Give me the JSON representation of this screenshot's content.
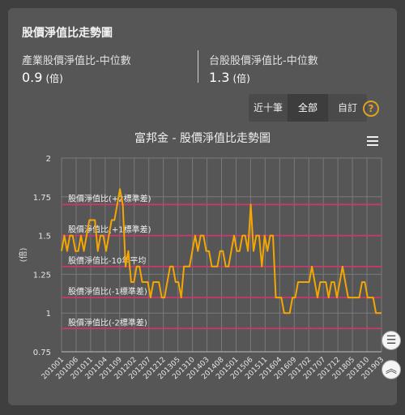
{
  "header": {
    "title": "股價淨值比走勢圖"
  },
  "stats": [
    {
      "label": "產業股價淨值比-中位數",
      "value": "0.9",
      "unit": "(倍)"
    },
    {
      "label": "台股股價淨值比-中位數",
      "value": "1.3",
      "unit": "(倍)"
    }
  ],
  "range_tabs": [
    "近十筆",
    "全部",
    "自訂"
  ],
  "active_tab": "全部",
  "help_icon": "?",
  "icons": {
    "menu": "hamburger-menu-icon",
    "help": "question-circle-icon",
    "list": "list-icon",
    "up": "double-chevron-up-icon"
  },
  "colors": {
    "series": "#f5a600",
    "band": "#d2356e",
    "background": "#565656"
  },
  "chart_data": {
    "type": "line",
    "title": "富邦金 - 股價淨值比走勢圖",
    "ylabel": "(倍)",
    "ylim": [
      0.75,
      2
    ],
    "yticks": [
      "0.75",
      "1",
      "1.25",
      "1.5",
      "1.75",
      "2"
    ],
    "xticks": [
      "201001",
      "201006",
      "201011",
      "201104",
      "201109",
      "201202",
      "201207",
      "201212",
      "201305",
      "201310",
      "201403",
      "201408",
      "201501",
      "201506",
      "201511",
      "201604",
      "201609",
      "201702",
      "201707",
      "201712",
      "201805",
      "201810",
      "201903"
    ],
    "grid": true,
    "bands": [
      {
        "label": "股價淨值比(+2標準差)",
        "value": 1.7
      },
      {
        "label": "股價淨值比(+1標準差)",
        "value": 1.5
      },
      {
        "label": "股價淨值比-10年平均",
        "value": 1.3
      },
      {
        "label": "股價淨值比(-1標準差)",
        "value": 1.1
      },
      {
        "label": "股價淨值比(-2標準差)",
        "value": 0.9
      }
    ],
    "series": [
      {
        "values": [
          1.4,
          1.5,
          1.4,
          1.5,
          1.5,
          1.4,
          1.4,
          1.5,
          1.4,
          1.5,
          1.6,
          1.6,
          1.6,
          1.4,
          1.5,
          1.5,
          1.4,
          1.5,
          1.6,
          1.6,
          1.7,
          1.8,
          1.7,
          1.3,
          1.4,
          1.2,
          1.2,
          1.3,
          1.3,
          1.2,
          1.2,
          1.2,
          1.1,
          1.2,
          1.2,
          1.2,
          1.1,
          1.1,
          1.2,
          1.3,
          1.3,
          1.2,
          1.2,
          1.1,
          1.3,
          1.3,
          1.3,
          1.4,
          1.5,
          1.4,
          1.5,
          1.5,
          1.4,
          1.4,
          1.3,
          1.3,
          1.3,
          1.4,
          1.4,
          1.3,
          1.3,
          1.4,
          1.5,
          1.4,
          1.4,
          1.5,
          1.5,
          1.4,
          1.7,
          1.4,
          1.5,
          1.5,
          1.3,
          1.5,
          1.4,
          1.5,
          1.5,
          1.1,
          1.1,
          1.1,
          1.0,
          1.0,
          1.0,
          1.1,
          1.1,
          1.2,
          1.2,
          1.2,
          1.2,
          1.2,
          1.3,
          1.2,
          1.1,
          1.2,
          1.2,
          1.2,
          1.1,
          1.2,
          1.2,
          1.1,
          1.2,
          1.3,
          1.2,
          1.1,
          1.1,
          1.1,
          1.1,
          1.1,
          1.2,
          1.2,
          1.1,
          1.1,
          1.1,
          1.0,
          1.0,
          1.0
        ]
      }
    ]
  }
}
